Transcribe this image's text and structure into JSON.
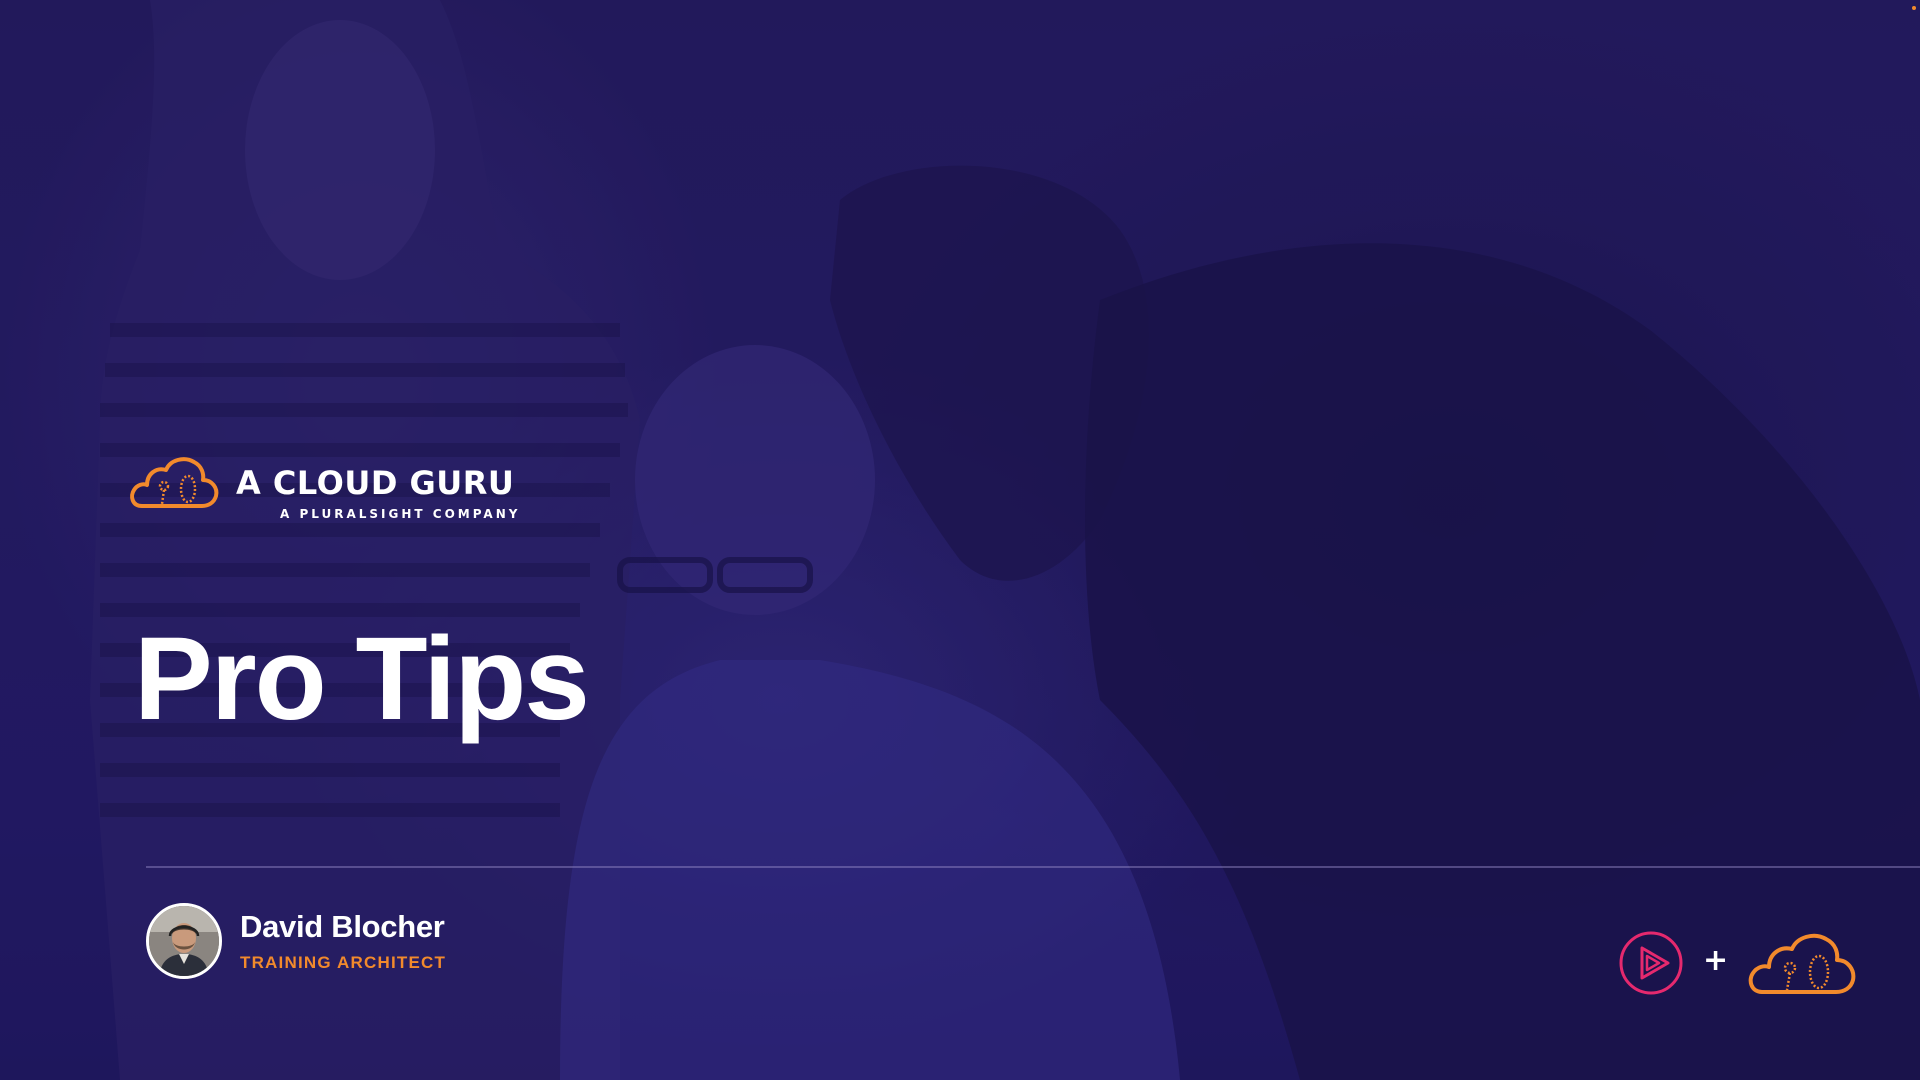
{
  "slide": {
    "brand": {
      "name": "A CLOUD GURU",
      "tagline": "A PLURALSIGHT COMPANY",
      "icon": "cloud-logo-icon"
    },
    "title": "Pro Tips",
    "presenter": {
      "name": "David Blocher",
      "role": "TRAINING ARCHITECT",
      "avatar_icon": "presenter-avatar"
    },
    "partner_logos": {
      "left_icon": "pluralsight-play-icon",
      "separator": "+",
      "right_icon": "cloud-logo-icon"
    }
  },
  "colors": {
    "background": "#221b5c",
    "accent_orange": "#f28a2c",
    "pluralsight_pink": "#e5296e",
    "text": "#ffffff"
  }
}
